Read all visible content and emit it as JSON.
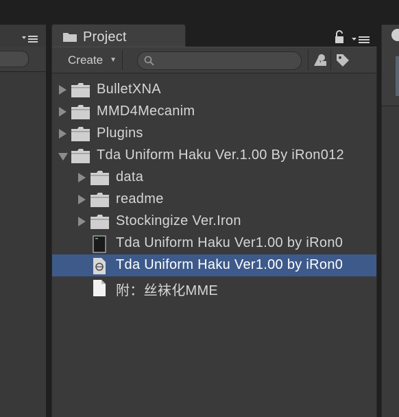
{
  "project_tab": {
    "label": "Project"
  },
  "toolbar": {
    "create_label": "Create",
    "search_placeholder": "",
    "search_value": ""
  },
  "tree": [
    {
      "label": "BulletXNA",
      "type": "folder",
      "expanded": false,
      "depth": 0,
      "selected": false
    },
    {
      "label": "MMD4Mecanim",
      "type": "folder",
      "expanded": false,
      "depth": 0,
      "selected": false
    },
    {
      "label": "Plugins",
      "type": "folder",
      "expanded": false,
      "depth": 0,
      "selected": false
    },
    {
      "label": "Tda Uniform Haku Ver.1.00 By iRon012",
      "type": "folder",
      "expanded": true,
      "depth": 0,
      "selected": false
    },
    {
      "label": "data",
      "type": "folder",
      "expanded": false,
      "depth": 1,
      "selected": false
    },
    {
      "label": "readme",
      "type": "folder",
      "expanded": false,
      "depth": 1,
      "selected": false
    },
    {
      "label": "Stockingize Ver.Iron",
      "type": "folder",
      "expanded": false,
      "depth": 1,
      "selected": false
    },
    {
      "label": "Tda Uniform Haku Ver1.00 by iRon0",
      "type": "file-script",
      "depth": 1,
      "selected": false
    },
    {
      "label": "Tda Uniform Haku Ver1.00 by iRon0",
      "type": "file-unity",
      "depth": 1,
      "selected": true
    },
    {
      "label": "附：丝袜化MME",
      "type": "file-text",
      "depth": 1,
      "selected": false
    }
  ],
  "icons": {
    "folder": "folder-icon",
    "lock": "lock-icon",
    "menu": "panel-menu-icon",
    "search": "search-icon",
    "filter_type": "filter-by-type-icon",
    "filter_label": "filter-by-label-icon"
  },
  "colors": {
    "background": "#393939",
    "selection": "#3d5a8a",
    "text": "#d6d6d6"
  }
}
